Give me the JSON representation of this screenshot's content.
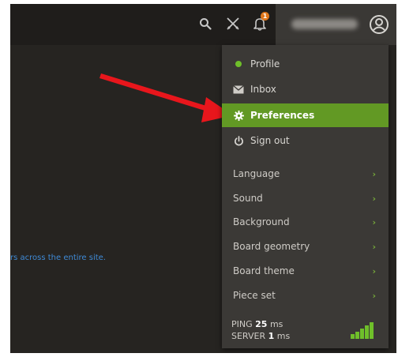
{
  "page_text": {
    "site_text": "rs across the entire site."
  },
  "topbar": {
    "icons": [
      "search-icon",
      "swords-icon",
      "bell-icon",
      "user-circle-icon"
    ],
    "notification_count": "1"
  },
  "menu": {
    "items": [
      {
        "label": "Profile",
        "icon": "online-dot-icon"
      },
      {
        "label": "Inbox",
        "icon": "envelope-icon"
      },
      {
        "label": "Preferences",
        "icon": "gear-icon",
        "active": true
      },
      {
        "label": "Sign out",
        "icon": "power-icon"
      }
    ],
    "sub_items": [
      {
        "label": "Language"
      },
      {
        "label": "Sound"
      },
      {
        "label": "Background"
      },
      {
        "label": "Board geometry"
      },
      {
        "label": "Board theme"
      },
      {
        "label": "Piece set"
      }
    ],
    "chevron": "›"
  },
  "status": {
    "ping_label": "PING",
    "ping_value": "25",
    "ping_unit": "ms",
    "server_label": "SERVER",
    "server_value": "1",
    "server_unit": "ms",
    "signal_bars": 5
  },
  "colors": {
    "accent_green": "#629924",
    "online_dot": "#6fbf2a",
    "arrow_red": "#e8161c",
    "badge_orange": "#e0761a",
    "link_blue": "#3f8ad6"
  }
}
